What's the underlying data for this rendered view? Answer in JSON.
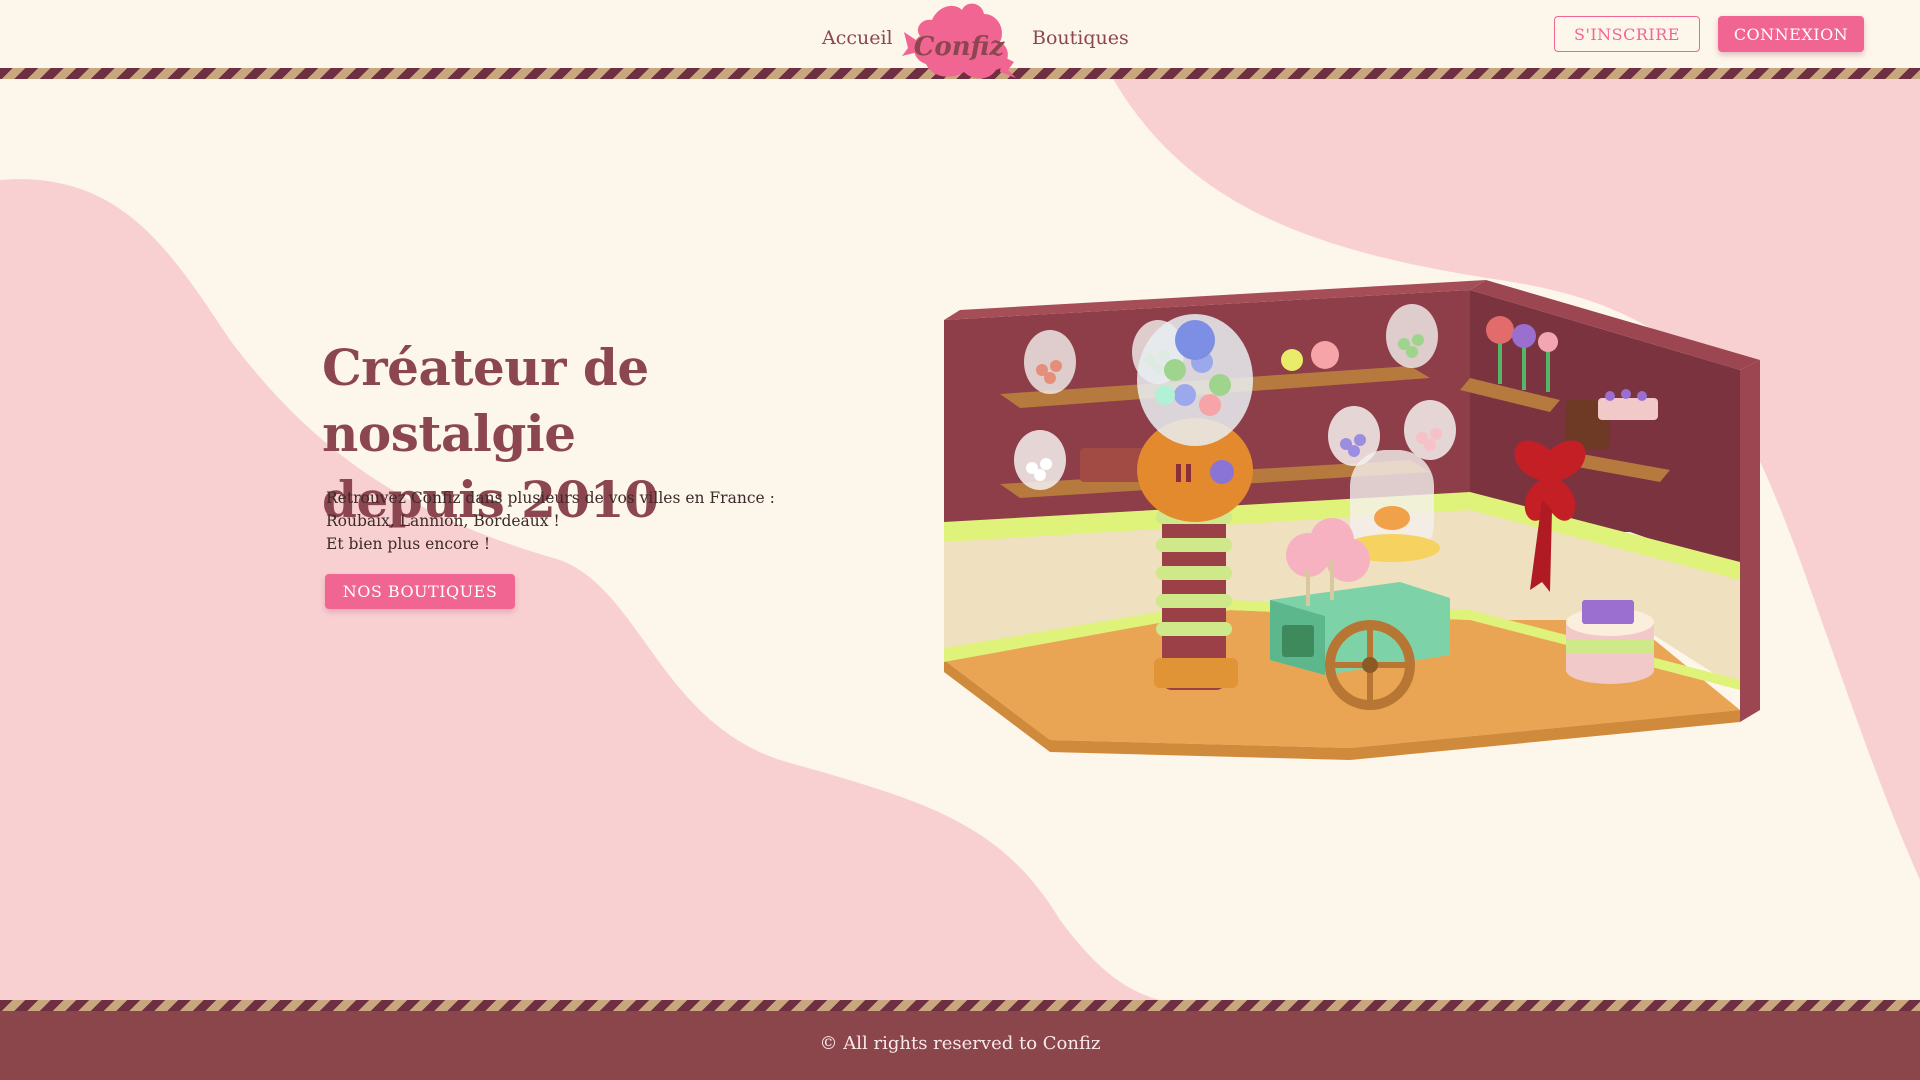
{
  "brand": {
    "logo_text": "Confiz",
    "colors": {
      "primary_pink": "#f06592",
      "burgundy": "#8c4650",
      "cream": "#fdf6eb",
      "soft_pink": "#f9d0d2",
      "footer": "#8b464c"
    }
  },
  "nav": {
    "links": [
      {
        "label": "Accueil"
      },
      {
        "label": "Boutiques"
      }
    ],
    "signup_label": "S'INSCRIRE",
    "login_label": "CONNEXION"
  },
  "hero": {
    "title_line1": "Créateur de nostalgie",
    "title_line2": "depuis 2010",
    "description": [
      "Retrouvez Confiz dans plusieurs de vos villes en France :",
      "Roubaix, Lannion, Bordeaux !",
      "Et bien plus encore !"
    ],
    "cta_label": "NOS BOUTIQUES",
    "illustration": "candy-shop-3d-room-illustration"
  },
  "footer": {
    "copyright": "© All rights reserved to Confiz"
  }
}
